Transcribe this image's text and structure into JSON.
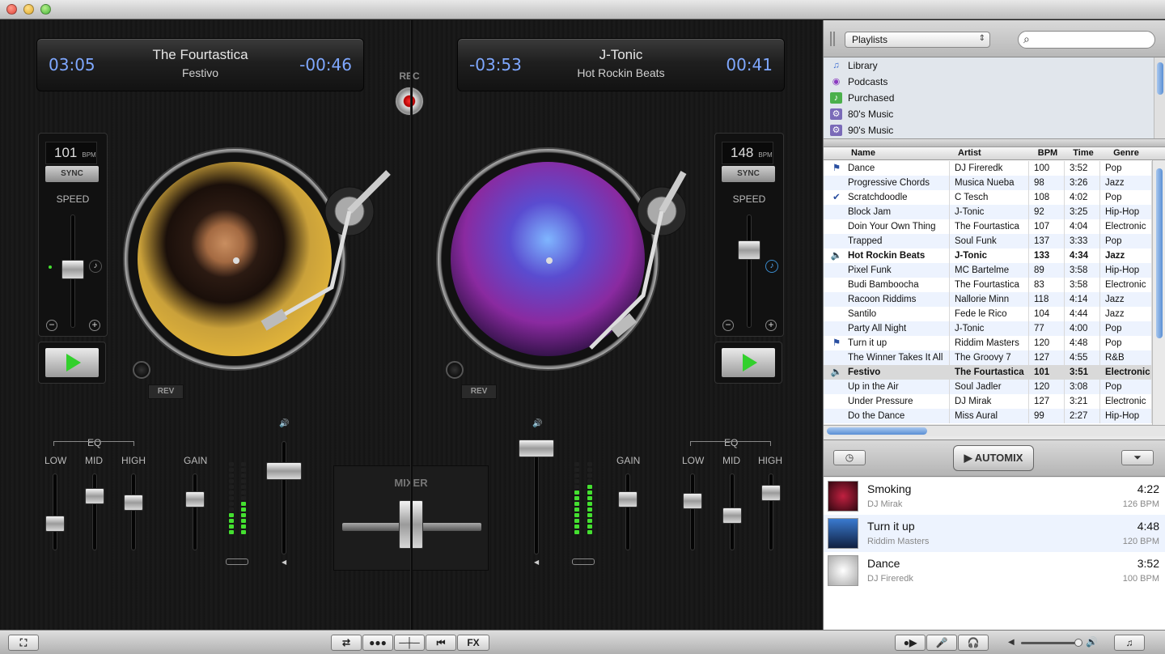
{
  "deckA": {
    "title": "The Fourtastica",
    "subtitle": "Festivo",
    "elapsed": "03:05",
    "remaining": "-00:46",
    "bpm": "101",
    "bpm_unit": "BPM",
    "sync": "SYNC",
    "speed": "SPEED",
    "rev": "REV"
  },
  "deckB": {
    "title": "J-Tonic",
    "subtitle": "Hot Rockin Beats",
    "elapsed": "-03:53",
    "remaining": "00:41",
    "bpm": "148",
    "bpm_unit": "BPM",
    "sync": "SYNC",
    "speed": "SPEED",
    "rev": "REV"
  },
  "rec": "REC",
  "mixer": {
    "label": "MIXER",
    "eq": "EQ",
    "low": "LOW",
    "mid": "MID",
    "high": "HIGH",
    "gain": "GAIN"
  },
  "sidebar": {
    "playlist_select": "Playlists",
    "search_placeholder": "",
    "playlists": [
      {
        "label": "Library",
        "icon": "music-note-icon"
      },
      {
        "label": "Podcasts",
        "icon": "podcast-icon"
      },
      {
        "label": "Purchased",
        "icon": "purchased-icon"
      },
      {
        "label": "80's Music",
        "icon": "smart-playlist-icon"
      },
      {
        "label": "90's Music",
        "icon": "smart-playlist-icon"
      }
    ],
    "columns": {
      "name": "Name",
      "artist": "Artist",
      "bpm": "BPM",
      "time": "Time",
      "genre": "Genre"
    },
    "tracks": [
      {
        "mark": "flag",
        "name": "Dance",
        "artist": "DJ Fireredk",
        "bpm": "100",
        "time": "3:52",
        "genre": "Pop"
      },
      {
        "mark": "",
        "name": "Progressive Chords",
        "artist": "Musica Nueba",
        "bpm": "98",
        "time": "3:26",
        "genre": "Jazz"
      },
      {
        "mark": "check",
        "name": "Scratchdoodle",
        "artist": "C Tesch",
        "bpm": "108",
        "time": "4:02",
        "genre": "Pop"
      },
      {
        "mark": "",
        "name": "Block Jam",
        "artist": "J-Tonic",
        "bpm": "92",
        "time": "3:25",
        "genre": "Hip-Hop"
      },
      {
        "mark": "",
        "name": "Doin Your Own Thing",
        "artist": "The Fourtastica",
        "bpm": "107",
        "time": "4:04",
        "genre": "Electronic"
      },
      {
        "mark": "",
        "name": "Trapped",
        "artist": "Soul Funk",
        "bpm": "137",
        "time": "3:33",
        "genre": "Pop"
      },
      {
        "mark": "speaker",
        "name": "Hot Rockin Beats",
        "artist": "J-Tonic",
        "bpm": "133",
        "time": "4:34",
        "genre": "Jazz",
        "bold": true
      },
      {
        "mark": "",
        "name": "Pixel Funk",
        "artist": "MC Bartelme",
        "bpm": "89",
        "time": "3:58",
        "genre": "Hip-Hop"
      },
      {
        "mark": "",
        "name": "Budi Bamboocha",
        "artist": "The Fourtastica",
        "bpm": "83",
        "time": "3:58",
        "genre": "Electronic"
      },
      {
        "mark": "",
        "name": "Racoon Riddims",
        "artist": "Nallorie Minn",
        "bpm": "118",
        "time": "4:14",
        "genre": "Jazz"
      },
      {
        "mark": "",
        "name": "Santilo",
        "artist": "Fede le Rico",
        "bpm": "104",
        "time": "4:44",
        "genre": "Jazz"
      },
      {
        "mark": "",
        "name": "Party All Night",
        "artist": "J-Tonic",
        "bpm": "77",
        "time": "4:00",
        "genre": "Pop"
      },
      {
        "mark": "flag",
        "name": "Turn it up",
        "artist": "Riddim Masters",
        "bpm": "120",
        "time": "4:48",
        "genre": "Pop"
      },
      {
        "mark": "",
        "name": "The Winner Takes It All",
        "artist": "The Groovy 7",
        "bpm": "127",
        "time": "4:55",
        "genre": "R&B"
      },
      {
        "mark": "speaker",
        "name": "Festivo",
        "artist": "The Fourtastica",
        "bpm": "101",
        "time": "3:51",
        "genre": "Electronic",
        "bold": true,
        "selected": true
      },
      {
        "mark": "",
        "name": "Up in the Air",
        "artist": "Soul Jadler",
        "bpm": "120",
        "time": "3:08",
        "genre": "Pop"
      },
      {
        "mark": "",
        "name": "Under Pressure",
        "artist": "DJ Mirak",
        "bpm": "127",
        "time": "3:21",
        "genre": "Electronic"
      },
      {
        "mark": "",
        "name": "Do the Dance",
        "artist": "Miss Aural",
        "bpm": "99",
        "time": "2:27",
        "genre": "Hip-Hop"
      }
    ],
    "automix": "AUTOMIX",
    "queue": [
      {
        "title": "Smoking",
        "artist": "DJ Mirak",
        "duration": "4:22",
        "bpm": "126 BPM"
      },
      {
        "title": "Turn it up",
        "artist": "Riddim Masters",
        "duration": "4:48",
        "bpm": "120 BPM"
      },
      {
        "title": "Dance",
        "artist": "DJ Fireredk",
        "duration": "3:52",
        "bpm": "100 BPM"
      }
    ]
  },
  "toolbar": {
    "fx": "FX"
  },
  "colors": {
    "time_blue": "#7fa8ff",
    "vu_green": "#44e030",
    "play_green": "#32d02c"
  }
}
